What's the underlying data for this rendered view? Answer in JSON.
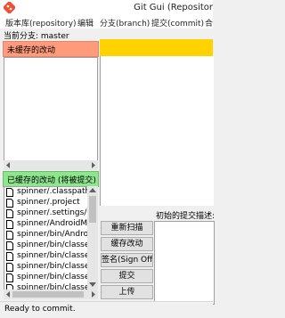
{
  "window": {
    "title": "Git Gui (Repositor"
  },
  "menu": [
    {
      "label": "版本库(repository)"
    },
    {
      "label": "编辑"
    },
    {
      "label": "分支(branch)"
    },
    {
      "label": "提交(commit)"
    },
    {
      "label": "合"
    }
  ],
  "branch": {
    "current": "当前分支: master"
  },
  "unstaged": {
    "title": "未缓存的改动"
  },
  "staged": {
    "title": "已缓存的改动 (将被提交)",
    "files": [
      "spinner/.classpath",
      "spinner/.project",
      "spinner/.settings/or",
      "spinner/AndroidMa",
      "spinner/bin/Androic",
      "spinner/bin/classes.",
      "spinner/bin/classes/",
      "spinner/bin/classes/",
      "spinner/bin/classes/",
      "spinner/bin/classes/"
    ]
  },
  "commit": {
    "message_label": "初始的提交描述:",
    "buttons": {
      "rescan": "重新扫描",
      "stage": "缓存改动",
      "signoff": "签名(Sign Off)",
      "commit": "提交",
      "push": "上传"
    }
  },
  "status": {
    "text": "Ready to commit."
  },
  "colors": {
    "unstaged_header": "#ff9b7b",
    "staged_header": "#8de58d",
    "diff_header": "#ffd200"
  }
}
